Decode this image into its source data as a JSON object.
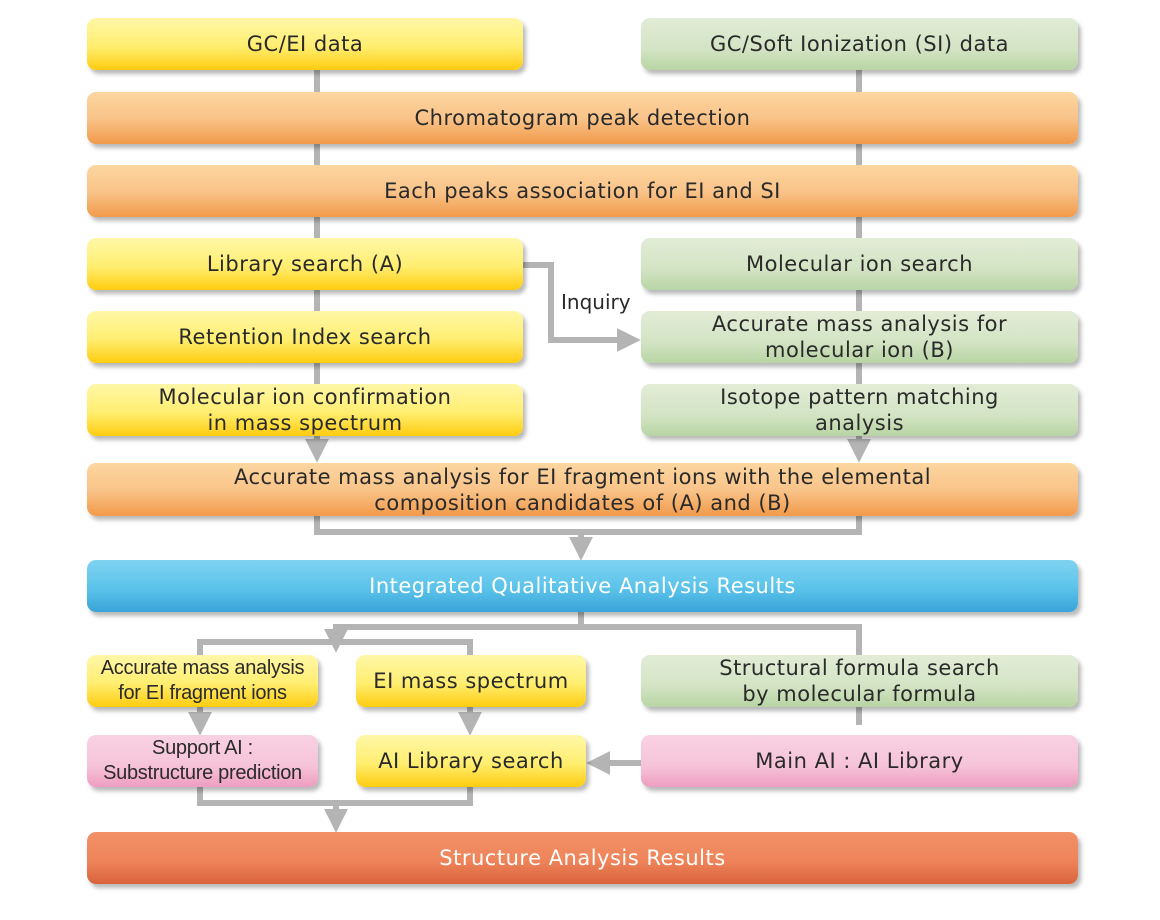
{
  "boxes": {
    "gc_ei": "GC/EI data",
    "gc_si": "GC/Soft Ionization (SI) data",
    "chromatogram": "Chromatogram peak detection",
    "association": "Each peaks association for EI and SI",
    "library_search": "Library search (A)",
    "molecular_ion_search": "Molecular ion search",
    "retention_index": "Retention Index search",
    "accurate_mass_molecular": "Accurate mass analysis for\nmolecular ion (B)",
    "molecular_ion_confirmation": "Molecular ion confirmation\nin mass spectrum",
    "isotope_pattern": "Isotope pattern matching\nanalysis",
    "accurate_mass_fragment": "Accurate mass analysis for EI fragment ions with the elemental\ncomposition candidates of (A) and (B)",
    "integrated_results": "Integrated Qualitative Analysis Results",
    "accurate_mass_fragment_small": "Accurate mass analysis\nfor EI fragment ions",
    "ei_mass_spectrum": "EI mass spectrum",
    "structural_formula_search": "Structural formula search\nby molecular formula",
    "support_ai": "Support AI :\nSubstructure prediction",
    "ai_library_search": "AI Library search",
    "main_ai": "Main AI : AI Library",
    "structure_results": "Structure Analysis Results"
  },
  "labels": {
    "inquiry": "Inquiry"
  },
  "colors": {
    "yellow": "#ffee70",
    "green": "#d3e4c4",
    "orange": "#f9c48a",
    "blue": "#5bc3ea",
    "pink": "#f6c3d8",
    "red": "#ef845a",
    "connector": "#b4b4b4"
  }
}
